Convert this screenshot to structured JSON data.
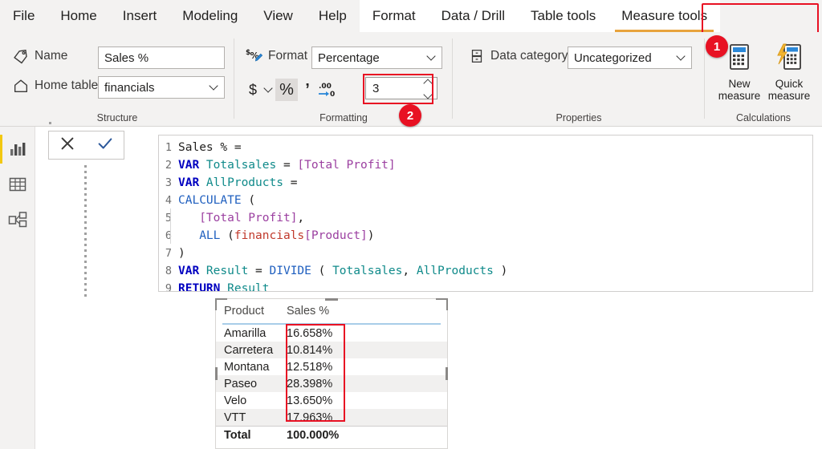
{
  "ribbon": {
    "tabs": [
      {
        "label": "File",
        "style": "plain"
      },
      {
        "label": "Home",
        "style": "plain"
      },
      {
        "label": "Insert",
        "style": "plain"
      },
      {
        "label": "Modeling",
        "style": "plain"
      },
      {
        "label": "View",
        "style": "plain"
      },
      {
        "label": "Help",
        "style": "plain"
      },
      {
        "label": "Format",
        "style": "boxed"
      },
      {
        "label": "Data / Drill",
        "style": "boxed"
      },
      {
        "label": "Table tools",
        "style": "boxed"
      },
      {
        "label": "Measure tools",
        "style": "active"
      }
    ],
    "groups": {
      "structure": {
        "label": "Structure",
        "name_label": "Name",
        "name_value": "Sales %",
        "name_icon": "tag-icon",
        "home_table_label": "Home table",
        "home_table_value": "financials",
        "home_table_icon": "home-icon"
      },
      "formatting": {
        "label": "Formatting",
        "format_label": "Format",
        "format_icon": "currency-percent-pencil-icon",
        "format_value": "Percentage",
        "currency_button": "$",
        "currency_chevron": "chevron-down-icon",
        "percent_button": "%",
        "thousands_button": "’",
        "decimal_button": ".00→0",
        "decimal_places_value": "3"
      },
      "properties": {
        "label": "Properties",
        "data_category_label": "Data category",
        "data_category_icon": "data-category-icon",
        "data_category_value": "Uncategorized"
      },
      "calculations": {
        "label": "Calculations",
        "buttons": [
          {
            "line1": "New",
            "line2": "measure",
            "icon": "calculator-icon"
          },
          {
            "line1": "Quick",
            "line2": "measure",
            "icon": "calculator-lightning-icon"
          }
        ]
      }
    }
  },
  "annotations": {
    "badge1": "1",
    "badge2": "2"
  },
  "rail": {
    "items": [
      {
        "name": "report-view",
        "icon": "bar-chart-icon"
      },
      {
        "name": "data-view",
        "icon": "table-grid-icon"
      },
      {
        "name": "model-view",
        "icon": "model-relationship-icon"
      }
    ]
  },
  "formula_bar": {
    "cancel_icon": "close-x-icon",
    "accept_icon": "checkmark-icon",
    "lines": [
      {
        "n": "1",
        "indent": false,
        "tokens": [
          {
            "t": "Sales % ",
            "c": "p"
          },
          {
            "t": "=",
            "c": "p"
          }
        ]
      },
      {
        "n": "2",
        "indent": false,
        "tokens": [
          {
            "t": "VAR ",
            "c": "k"
          },
          {
            "t": "Totalsales ",
            "c": "v"
          },
          {
            "t": "= ",
            "c": "p"
          },
          {
            "t": "[Total Profit]",
            "c": "m"
          }
        ]
      },
      {
        "n": "3",
        "indent": false,
        "tokens": [
          {
            "t": "VAR ",
            "c": "k"
          },
          {
            "t": "AllProducts ",
            "c": "v"
          },
          {
            "t": "=",
            "c": "p"
          }
        ]
      },
      {
        "n": "4",
        "indent": false,
        "tokens": [
          {
            "t": "CALCULATE ",
            "c": "f"
          },
          {
            "t": "(",
            "c": "p"
          }
        ]
      },
      {
        "n": "5",
        "indent": true,
        "tokens": [
          {
            "t": "   ",
            "c": "p"
          },
          {
            "t": "[Total Profit]",
            "c": "m"
          },
          {
            "t": ",",
            "c": "p"
          }
        ]
      },
      {
        "n": "6",
        "indent": true,
        "tokens": [
          {
            "t": "   ",
            "c": "p"
          },
          {
            "t": "ALL ",
            "c": "f"
          },
          {
            "t": "(",
            "c": "p"
          },
          {
            "t": "financials",
            "c": "t"
          },
          {
            "t": "[Product]",
            "c": "m"
          },
          {
            "t": ")",
            "c": "p"
          }
        ]
      },
      {
        "n": "7",
        "indent": false,
        "tokens": [
          {
            "t": ")",
            "c": "p"
          }
        ]
      },
      {
        "n": "8",
        "indent": false,
        "tokens": [
          {
            "t": "VAR ",
            "c": "k"
          },
          {
            "t": "Result ",
            "c": "v"
          },
          {
            "t": "= ",
            "c": "p"
          },
          {
            "t": "DIVIDE ",
            "c": "f"
          },
          {
            "t": "( ",
            "c": "p"
          },
          {
            "t": "Totalsales",
            "c": "v"
          },
          {
            "t": ", ",
            "c": "p"
          },
          {
            "t": "AllProducts ",
            "c": "v"
          },
          {
            "t": ")",
            "c": "p"
          }
        ]
      },
      {
        "n": "9",
        "indent": false,
        "tokens": [
          {
            "t": "RETURN ",
            "c": "k"
          },
          {
            "t": "Result",
            "c": "v"
          }
        ]
      }
    ]
  },
  "visual": {
    "columns": [
      "Product",
      "Sales %"
    ],
    "rows": [
      [
        "Amarilla",
        "16.658%"
      ],
      [
        "Carretera",
        "10.814%"
      ],
      [
        "Montana",
        "12.518%"
      ],
      [
        "Paseo",
        "28.398%"
      ],
      [
        "Velo",
        "13.650%"
      ],
      [
        "VTT",
        "17.963%"
      ]
    ],
    "total": [
      "Total",
      "100.000%"
    ]
  },
  "colors": {
    "accent": "#f2c811",
    "annotation": "#e81123",
    "ribbon_bg": "#f3f2f1",
    "header_rule": "#a8cde8"
  }
}
